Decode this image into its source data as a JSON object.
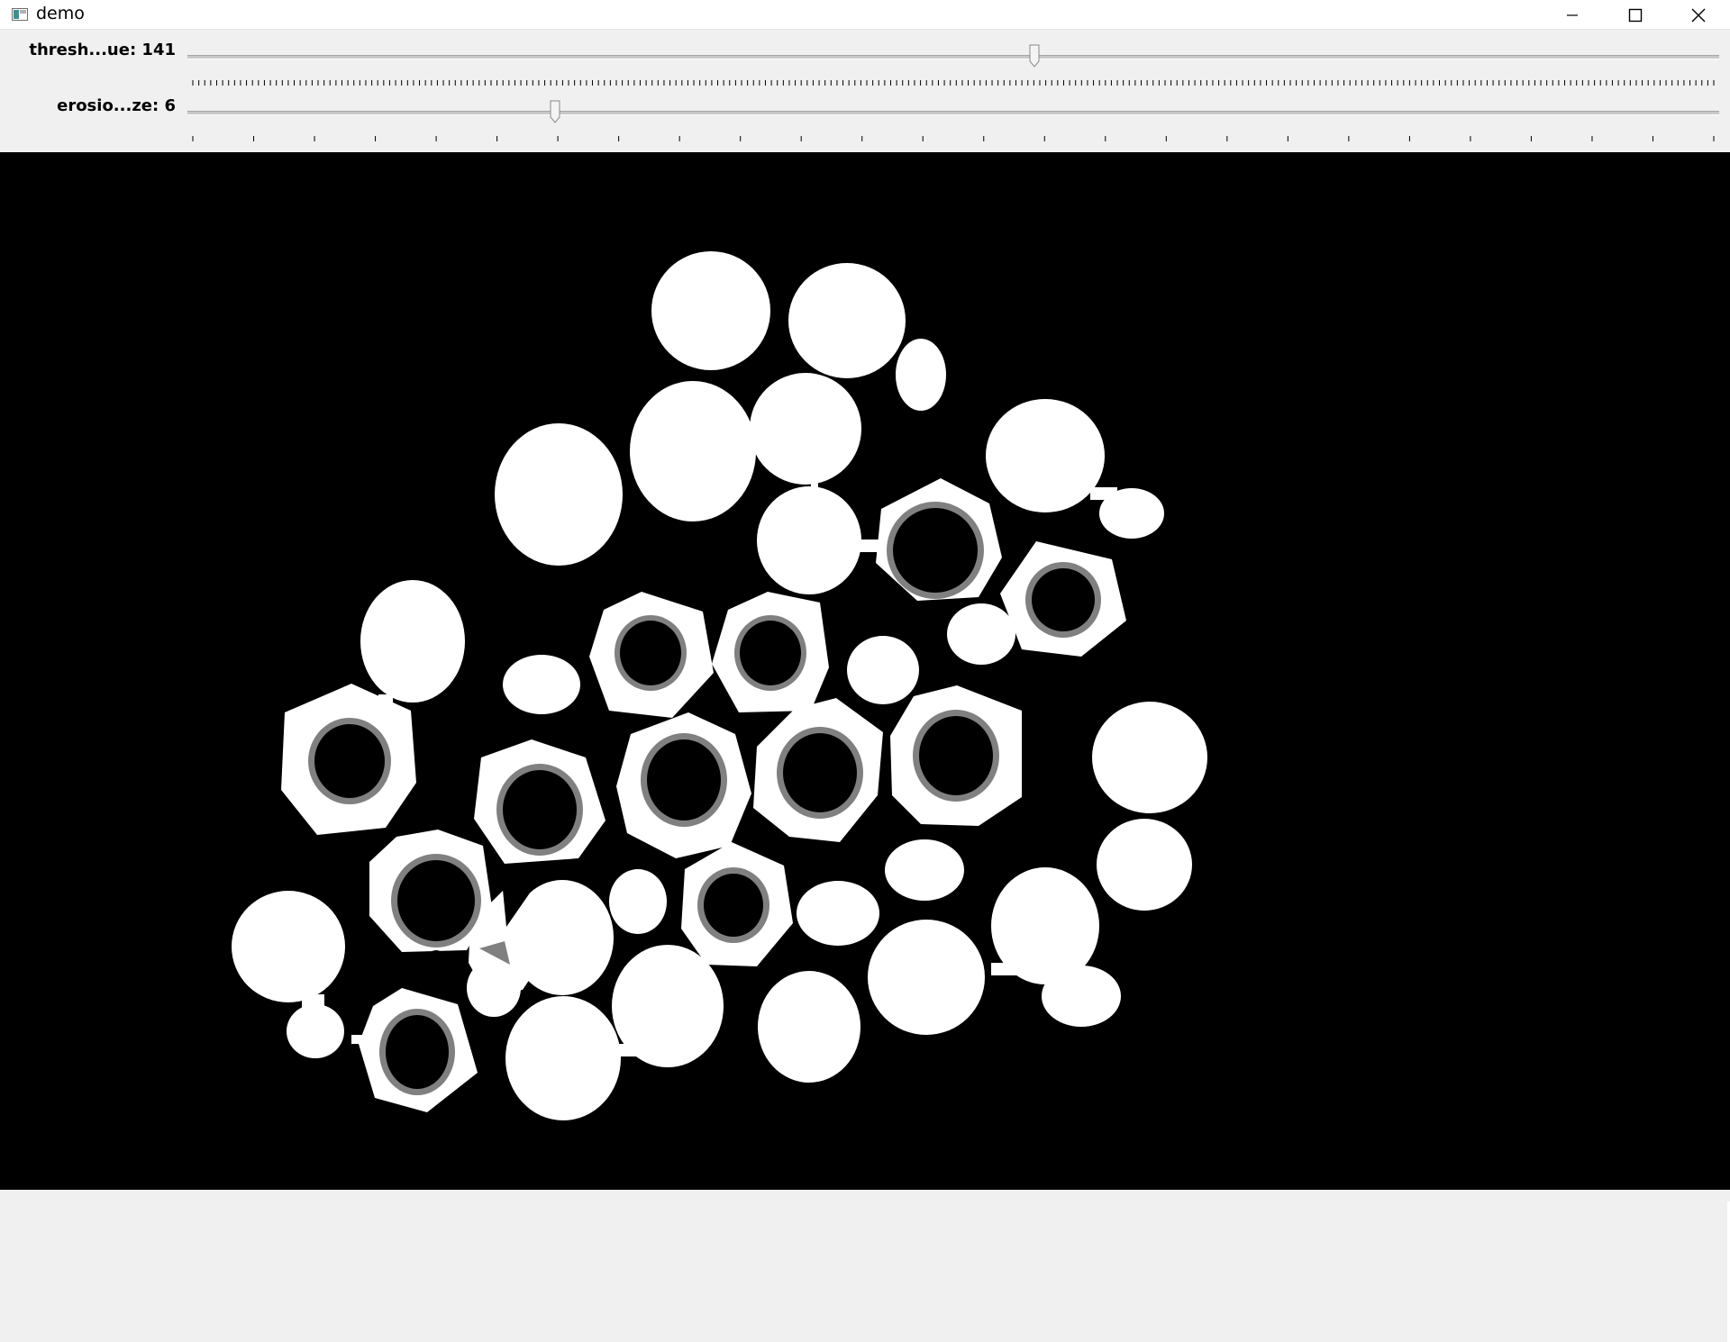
{
  "window": {
    "title": "demo",
    "controls": [
      "minimize-icon",
      "maximize-icon",
      "close-icon"
    ]
  },
  "trackbars": [
    {
      "label": "thresh...ue: 141",
      "value": 141,
      "max": 255
    },
    {
      "label": "erosio...ze: 6",
      "value": 6,
      "max": 25
    }
  ],
  "image": {
    "description_colors": {
      "background": "#000000",
      "foreground": "#ffffff",
      "ring": "#808080"
    }
  }
}
